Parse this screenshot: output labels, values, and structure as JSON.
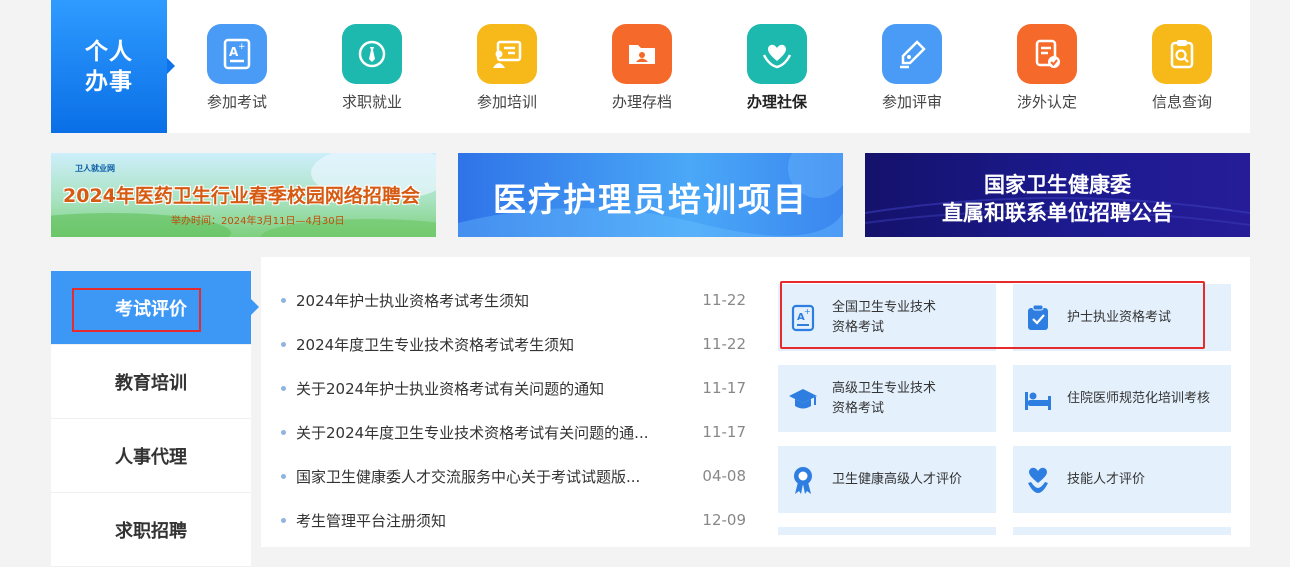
{
  "services": {
    "personal_label_l1": "个人",
    "personal_label_l2": "办事",
    "items": [
      {
        "label": "参加考试",
        "icon": "exam-icon",
        "color": "#4a9bf5"
      },
      {
        "label": "求职就业",
        "icon": "tie-icon",
        "color": "#1db9ae"
      },
      {
        "label": "参加培训",
        "icon": "training-board-icon",
        "color": "#f7b91a"
      },
      {
        "label": "办理存档",
        "icon": "folder-user-icon",
        "color": "#f56a2a"
      },
      {
        "label": "办理社保",
        "icon": "heart-hands-icon",
        "color": "#1db9ae"
      },
      {
        "label": "参加评审",
        "icon": "pen-nib-icon",
        "color": "#4a9bf5"
      },
      {
        "label": "涉外认定",
        "icon": "document-check-icon",
        "color": "#f56a2a"
      },
      {
        "label": "信息查询",
        "icon": "clipboard-search-icon",
        "color": "#f7b91a"
      }
    ]
  },
  "banners": {
    "b1_logo": "卫人就业网",
    "b1_title": "2024年医药卫生行业春季校园网络招聘会",
    "b1_sub": "举办时间：2024年3月11日—4月30日",
    "b2_title": "医疗护理员培训项目",
    "b3_line1": "国家卫生健康委",
    "b3_line2": "直属和联系单位招聘公告"
  },
  "nav": {
    "items": [
      "考试评价",
      "教育培训",
      "人事代理",
      "求职招聘"
    ]
  },
  "news": [
    {
      "title": "2024年护士执业资格考试考生须知",
      "date": "11-22"
    },
    {
      "title": "2024年度卫生专业技术资格考试考生须知",
      "date": "11-22"
    },
    {
      "title": "关于2024年护士执业资格考试有关问题的通知",
      "date": "11-17"
    },
    {
      "title": "关于2024年度卫生专业技术资格考试有关问题的通...",
      "date": "11-17"
    },
    {
      "title": "国家卫生健康委人才交流服务中心关于考试试题版...",
      "date": "04-08"
    },
    {
      "title": "考生管理平台注册须知",
      "date": "12-09"
    }
  ],
  "tiles": [
    {
      "l1": "全国卫生专业技术",
      "l2": "资格考试",
      "icon": "exam-badge-icon"
    },
    {
      "l1": "护士执业资格考试",
      "l2": "",
      "icon": "clipboard-check-icon"
    },
    {
      "l1": "高级卫生专业技术",
      "l2": "资格考试",
      "icon": "graduation-cap-icon"
    },
    {
      "l1": "住院医师规范化培训考核",
      "l2": "",
      "icon": "hospital-bed-icon"
    },
    {
      "l1": "卫生健康高级人才评价",
      "l2": "",
      "icon": "award-ribbon-icon"
    },
    {
      "l1": "技能人才评价",
      "l2": "",
      "icon": "heart-hand-icon"
    }
  ]
}
